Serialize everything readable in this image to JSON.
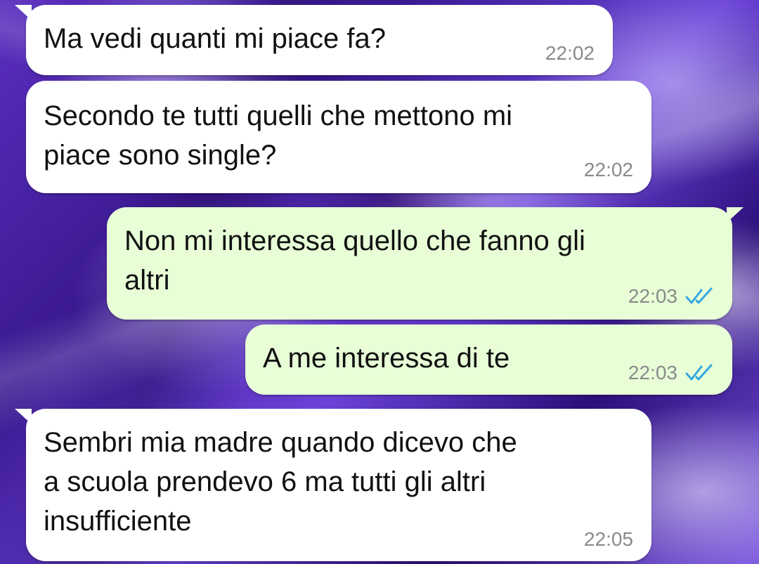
{
  "colors": {
    "incoming_bubble": "#ffffff",
    "outgoing_bubble": "#e7fed7",
    "timestamp": "#8a8a8a",
    "read_ticks": "#34a7e0"
  },
  "messages": [
    {
      "direction": "incoming",
      "text": "Ma vedi quanti mi piace fa?",
      "time": "22:02"
    },
    {
      "direction": "incoming",
      "text": "Secondo te tutti quelli che mettono mi\npiace sono single?",
      "time": "22:02"
    },
    {
      "direction": "outgoing",
      "text": "Non mi interessa quello che fanno gli\naltri",
      "time": "22:03",
      "status_icon": "double-check-read-icon"
    },
    {
      "direction": "outgoing",
      "text": "A me interessa di te",
      "time": "22:03",
      "status_icon": "double-check-read-icon"
    },
    {
      "direction": "incoming",
      "text": "Sembri mia madre quando dicevo che\na scuola prendevo 6 ma tutti gli altri\ninsufficiente",
      "time": "22:05"
    }
  ]
}
